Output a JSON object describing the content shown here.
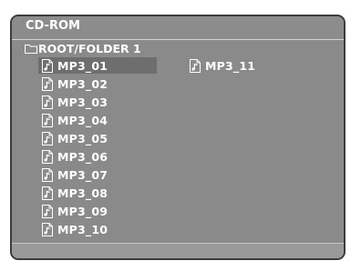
{
  "window": {
    "title": "CD-ROM"
  },
  "path": {
    "label": "ROOT/FOLDER 1",
    "icon": "folder-icon"
  },
  "files": [
    {
      "name": "MP3_01",
      "icon": "music-file-icon",
      "selected": true
    },
    {
      "name": "MP3_02",
      "icon": "music-file-icon"
    },
    {
      "name": "MP3_03",
      "icon": "music-file-icon"
    },
    {
      "name": "MP3_04",
      "icon": "music-file-icon"
    },
    {
      "name": "MP3_05",
      "icon": "music-file-icon"
    },
    {
      "name": "MP3_06",
      "icon": "music-file-icon"
    },
    {
      "name": "MP3_07",
      "icon": "music-file-icon"
    },
    {
      "name": "MP3_08",
      "icon": "music-file-icon"
    },
    {
      "name": "MP3_09",
      "icon": "music-file-icon"
    },
    {
      "name": "MP3_10",
      "icon": "music-file-icon"
    },
    {
      "name": "MP3_11",
      "icon": "music-file-icon"
    }
  ],
  "colors": {
    "background": "#8a8a8a",
    "selection": "#6e6e6e",
    "text": "#ffffff"
  }
}
